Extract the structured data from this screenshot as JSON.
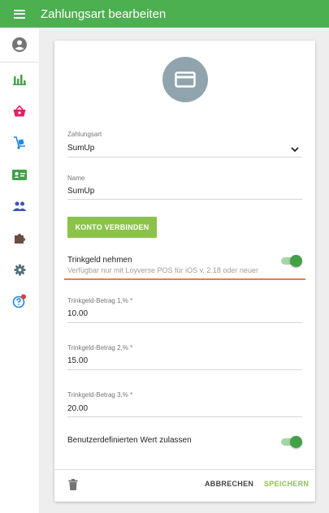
{
  "header": {
    "title": "Zahlungsart bearbeiten",
    "color": "#4caf50"
  },
  "sidebar": {
    "items": [
      {
        "icon": "account-icon",
        "color": "#757575"
      },
      {
        "icon": "bar-chart-icon",
        "color": "#43a047"
      },
      {
        "icon": "basket-icon",
        "color": "#e91e63"
      },
      {
        "icon": "hand-truck-icon",
        "color": "#1e88e5"
      },
      {
        "icon": "id-card-icon",
        "color": "#43a047"
      },
      {
        "icon": "people-icon",
        "color": "#3f51b5"
      },
      {
        "icon": "puzzle-icon",
        "color": "#6d4c41"
      },
      {
        "icon": "gear-icon",
        "color": "#546e7a"
      },
      {
        "icon": "help-icon",
        "color": "#1e88e5"
      }
    ]
  },
  "form": {
    "payment_type_label": "Zahlungsart",
    "payment_type_value": "SumUp",
    "name_label": "Name",
    "name_value": "SumUp",
    "connect_button": "KONTO VERBINDEN",
    "tip_label": "Trinkgeld nehmen",
    "tip_note": "Verfügbar nur mit Loyverse POS für iOS v. 2.18 oder neuer",
    "tip_enabled": true,
    "tip_amounts": [
      {
        "label": "Trinkgeld-Betrag 1,% *",
        "value": "10.00"
      },
      {
        "label": "Trinkgeld-Betrag 2,% *",
        "value": "15.00"
      },
      {
        "label": "Trinkgeld-Betrag 3,% *",
        "value": "20.00"
      }
    ],
    "custom_value_label": "Benutzerdefinierten Wert zulassen",
    "custom_value_enabled": true
  },
  "footer": {
    "cancel": "ABBRECHEN",
    "save": "SPEICHERN"
  },
  "colors": {
    "accent": "#8bc34a",
    "toggle_on": "#43a047",
    "highlight_line": "#e97f37",
    "avatar_bg": "#90a4ae"
  }
}
